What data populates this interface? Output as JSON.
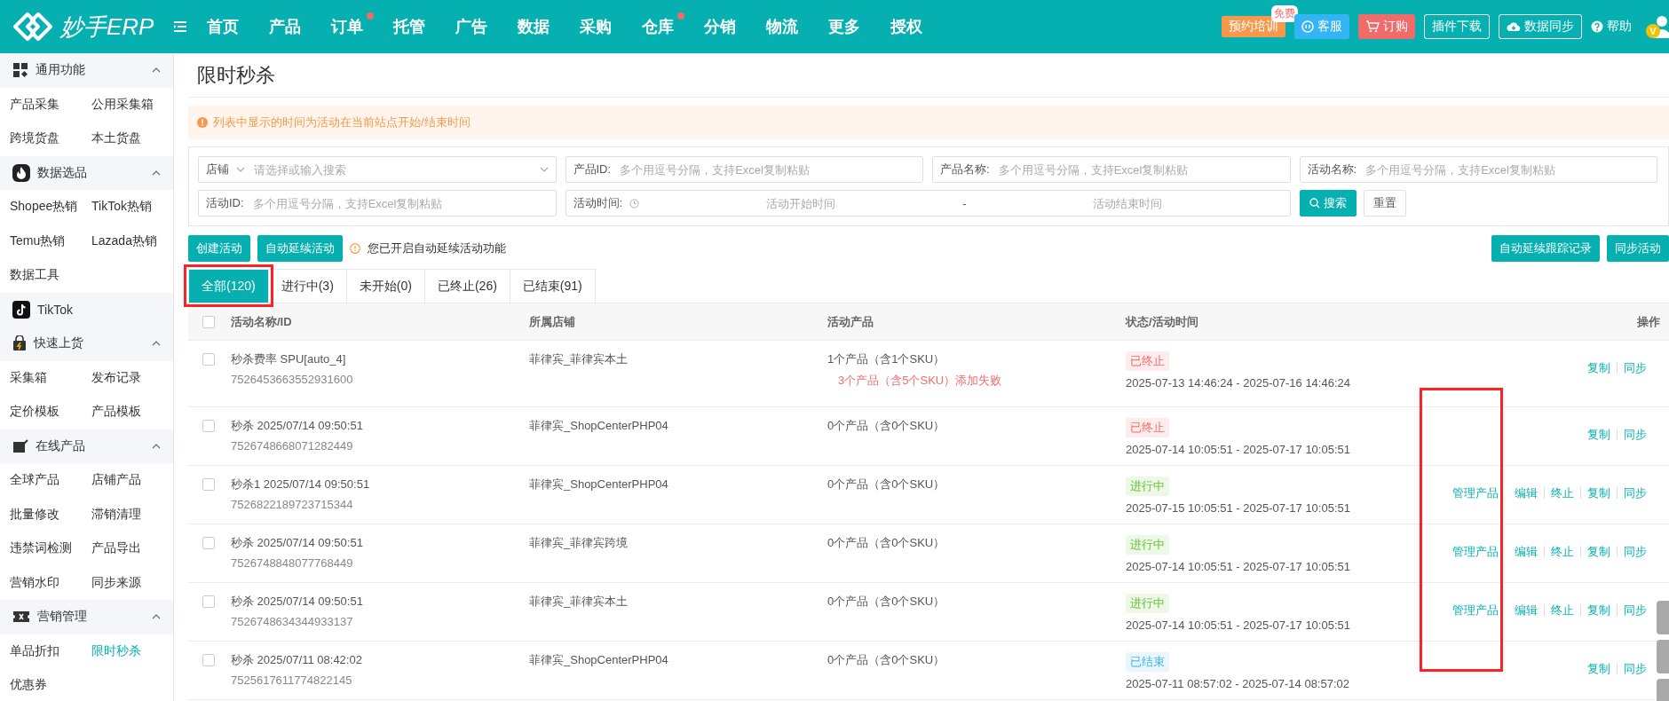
{
  "topbar": {
    "logo": "妙手ERP",
    "nav": [
      {
        "label": "首页",
        "dot": false
      },
      {
        "label": "产品",
        "dot": false
      },
      {
        "label": "订单",
        "dot": true
      },
      {
        "label": "托管",
        "dot": false
      },
      {
        "label": "广告",
        "dot": false
      },
      {
        "label": "数据",
        "dot": false
      },
      {
        "label": "采购",
        "dot": false
      },
      {
        "label": "仓库",
        "dot": true
      },
      {
        "label": "分销",
        "dot": false
      },
      {
        "label": "物流",
        "dot": false
      },
      {
        "label": "更多",
        "dot": false
      },
      {
        "label": "授权",
        "dot": false
      }
    ],
    "actions": [
      {
        "label": "预约培训",
        "kind": "training",
        "badge": "免费"
      },
      {
        "label": "客服",
        "kind": "service"
      },
      {
        "label": "订购",
        "kind": "order"
      },
      {
        "label": "插件下载",
        "kind": "outline"
      },
      {
        "label": "数据同步",
        "kind": "sync"
      },
      {
        "label": "帮助",
        "kind": "help"
      }
    ],
    "vip_badge": "V"
  },
  "sidebar": [
    {
      "title": "通用功能",
      "expanded": true,
      "items": [
        {
          "label": "产品采集",
          "selected": false
        },
        {
          "label": "公用采集箱",
          "selected": false
        },
        {
          "label": "跨境货盘",
          "selected": false
        },
        {
          "label": "本土货盘",
          "selected": false
        }
      ]
    },
    {
      "title": "数据选品",
      "expanded": true,
      "items": [
        {
          "label": "Shopee热销",
          "selected": false
        },
        {
          "label": "TikTok热销",
          "selected": false
        },
        {
          "label": "Temu热销",
          "selected": false
        },
        {
          "label": "Lazada热销",
          "selected": false
        },
        {
          "label": "数据工具",
          "selected": false
        }
      ]
    },
    {
      "title": "TikTok"
    },
    {
      "title": "快速上货",
      "expanded": true,
      "items": [
        {
          "label": "采集箱",
          "selected": false
        },
        {
          "label": "发布记录",
          "selected": false
        },
        {
          "label": "定价模板",
          "selected": false
        },
        {
          "label": "产品模板",
          "selected": false
        }
      ]
    },
    {
      "title": "在线产品",
      "expanded": true,
      "items": [
        {
          "label": "全球产品",
          "selected": false
        },
        {
          "label": "店铺产品",
          "selected": false
        },
        {
          "label": "批量修改",
          "selected": false
        },
        {
          "label": "滞销清理",
          "selected": false
        },
        {
          "label": "违禁词检测",
          "selected": false
        },
        {
          "label": "产品导出",
          "selected": false
        },
        {
          "label": "营销水印",
          "selected": false
        },
        {
          "label": "同步来源",
          "selected": false
        }
      ]
    },
    {
      "title": "营销管理",
      "expanded": true,
      "items": [
        {
          "label": "单品折扣",
          "selected": false
        },
        {
          "label": "限时秒杀",
          "selected": true
        },
        {
          "label": "优惠券",
          "selected": false
        }
      ]
    }
  ],
  "page_title": "限时秒杀",
  "notice": "列表中显示的时间为活动在当前站点开始/结束时间",
  "filters": [
    {
      "kind": "select",
      "label": "店铺",
      "placeholder": "请选择或输入搜索"
    },
    {
      "kind": "input",
      "label": "产品ID:",
      "placeholder": "多个用逗号分隔，支持Excel复制粘贴"
    },
    {
      "kind": "input",
      "label": "产品名称:",
      "placeholder": "多个用逗号分隔，支持Excel复制粘贴"
    },
    {
      "kind": "input",
      "label": "活动名称:",
      "placeholder": "多个用逗号分隔，支持Excel复制粘贴"
    },
    {
      "kind": "input",
      "label": "活动ID:",
      "placeholder": "多个用逗号分隔，支持Excel复制粘贴"
    },
    {
      "kind": "daterange",
      "label": "活动时间:",
      "start_placeholder": "活动开始时间",
      "separator": "-",
      "end_placeholder": "活动结束时间"
    }
  ],
  "filter_buttons": [
    {
      "label": "搜索",
      "kind": "primary"
    },
    {
      "label": "重置",
      "kind": "plain"
    }
  ],
  "toolbar": {
    "left": [
      "创建活动",
      "自动延续活动"
    ],
    "hint": "您已开启自动延续活动功能",
    "right": [
      "自动延续跟踪记录",
      "同步活动"
    ]
  },
  "tabs": [
    {
      "label": "全部(120)",
      "selected": true,
      "highlighted": true
    },
    {
      "label": "进行中(3)",
      "selected": false,
      "highlighted": false
    },
    {
      "label": "未开始(0)",
      "selected": false,
      "highlighted": false
    },
    {
      "label": "已终止(26)",
      "selected": false,
      "highlighted": false
    },
    {
      "label": "已结束(91)",
      "selected": false,
      "highlighted": false
    }
  ],
  "table": {
    "columns": [
      "活动名称/ID",
      "所属店铺",
      "活动产品",
      "状态/活动时间",
      "操作"
    ],
    "manage_column_highlighted": true,
    "select_all_checked": false,
    "rows": [
      {
        "checked": false,
        "name": "秒杀费率 SPU[auto_4]",
        "id": "7526453663552931600",
        "store": "菲律宾_菲律宾本土",
        "products": "1个产品（含1个SKU）",
        "error": "3个产品（含5个SKU）添加失败",
        "status": {
          "label": "已终止",
          "kind": "stopped"
        },
        "time": "2025-07-13 14:46:24 - 2025-07-16 14:46:24",
        "actions": [
          "复制",
          "同步"
        ]
      },
      {
        "checked": false,
        "name": "秒杀 2025/07/14 09:50:51",
        "id": "7526748668071282449",
        "store": "菲律宾_ShopCenterPHP04",
        "products": "0个产品（含0个SKU）",
        "status": {
          "label": "已终止",
          "kind": "stopped"
        },
        "time": "2025-07-14 10:05:51 - 2025-07-17 10:05:51",
        "actions": [
          "复制",
          "同步"
        ]
      },
      {
        "checked": false,
        "name": "秒杀1 2025/07/14 09:50:51",
        "id": "7526822189723715344",
        "store": "菲律宾_ShopCenterPHP04",
        "products": "0个产品（含0个SKU）",
        "status": {
          "label": "进行中",
          "kind": "running"
        },
        "time": "2025-07-15 10:05:51 - 2025-07-17 10:05:51",
        "manage": "管理产品",
        "actions": [
          "编辑",
          "终止",
          "复制",
          "同步"
        ]
      },
      {
        "checked": false,
        "name": "秒杀 2025/07/14 09:50:51",
        "id": "7526748848077768449",
        "store": "菲律宾_菲律宾跨境",
        "products": "0个产品（含0个SKU）",
        "status": {
          "label": "进行中",
          "kind": "running"
        },
        "time": "2025-07-14 10:05:51 - 2025-07-17 10:05:51",
        "manage": "管理产品",
        "actions": [
          "编辑",
          "终止",
          "复制",
          "同步"
        ]
      },
      {
        "checked": false,
        "name": "秒杀 2025/07/14 09:50:51",
        "id": "7526748634344933137",
        "store": "菲律宾_菲律宾本土",
        "products": "0个产品（含0个SKU）",
        "status": {
          "label": "进行中",
          "kind": "running"
        },
        "time": "2025-07-14 10:05:51 - 2025-07-17 10:05:51",
        "manage": "管理产品",
        "actions": [
          "编辑",
          "终止",
          "复制",
          "同步"
        ]
      },
      {
        "checked": false,
        "name": "秒杀 2025/07/11 08:42:02",
        "id": "7525617611774822145",
        "store": "菲律宾_ShopCenterPHP04",
        "products": "0个产品（含0个SKU）",
        "status": {
          "label": "已结束",
          "kind": "finished"
        },
        "time": "2025-07-11 08:57:02 - 2025-07-14 08:57:02",
        "actions": [
          "复制",
          "同步"
        ]
      }
    ]
  }
}
